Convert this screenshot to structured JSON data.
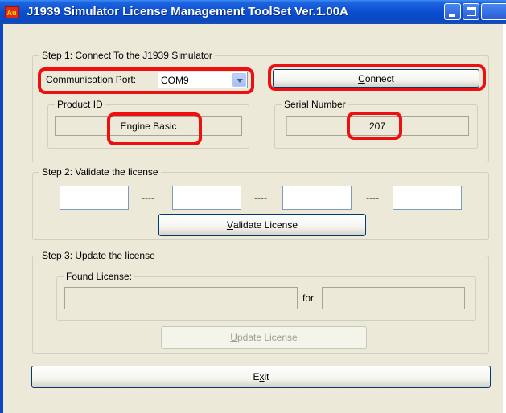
{
  "window": {
    "title": "J1939 Simulator License Management ToolSet Ver.1.00A",
    "app_icon_text": "Au"
  },
  "step1": {
    "title": "Step 1: Connect To the J1939 Simulator",
    "com_port_label": "Communication Port:",
    "com_port_value": "COM9",
    "connect_label_prefix": "",
    "connect_label_ul": "C",
    "connect_label_rest": "onnect",
    "product_id_title": "Product ID",
    "product_id_value": "Engine Basic",
    "serial_title": "Serial Number",
    "serial_value": "207"
  },
  "step2": {
    "title": "Step 2: Validate the license",
    "key_parts": [
      "",
      "",
      "",
      ""
    ],
    "separator": "----",
    "validate_label_ul": "V",
    "validate_label_rest": "alidate License"
  },
  "step3": {
    "title": "Step 3: Update the license",
    "found_title": "Found License:",
    "found_value": "",
    "for_label": "for",
    "for_value": "",
    "update_label_ul": "U",
    "update_label_rest": "pdate License"
  },
  "exit": {
    "label_pre": "E",
    "label_ul": "x",
    "label_rest": "it"
  },
  "colors": {
    "annotation": "#ee1010",
    "titlebar": "#0a4fd1",
    "dialog_bg": "#ece9d8"
  }
}
